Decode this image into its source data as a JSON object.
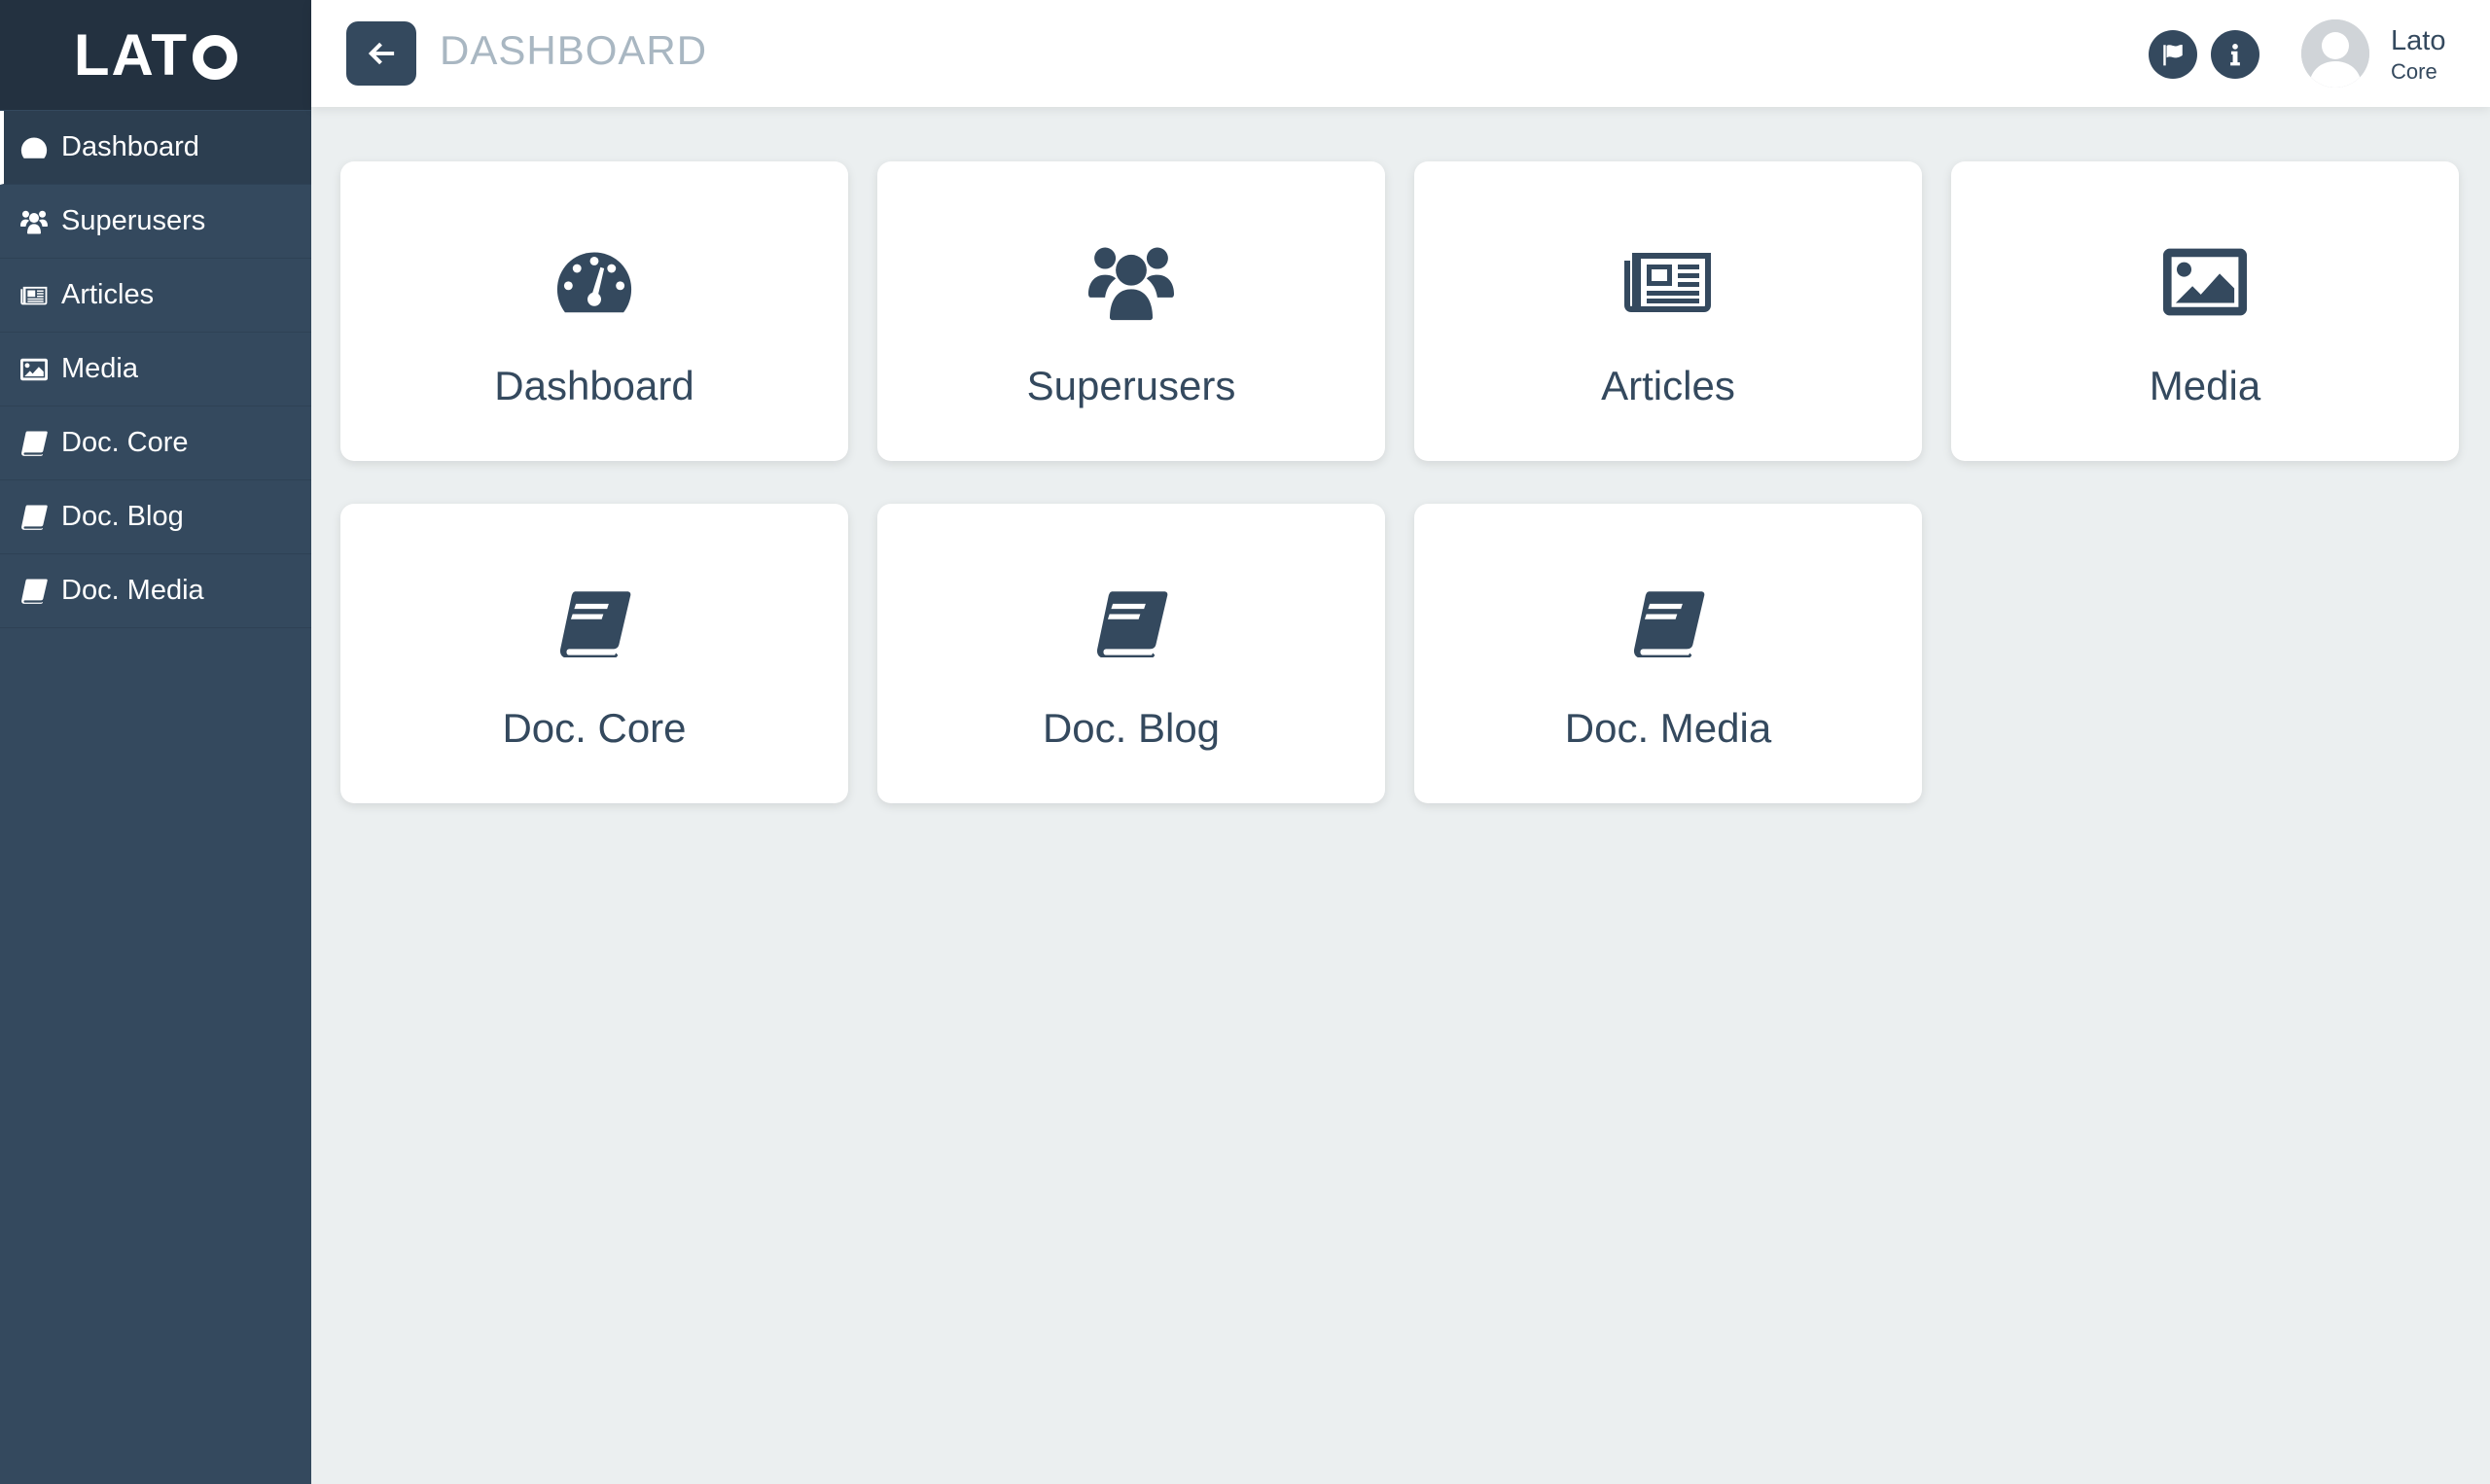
{
  "app": {
    "logo": "LATO"
  },
  "sidebar": {
    "items": [
      {
        "label": "Dashboard",
        "icon": "tachometer-icon",
        "active": true
      },
      {
        "label": "Superusers",
        "icon": "users-icon"
      },
      {
        "label": "Articles",
        "icon": "newspaper-icon"
      },
      {
        "label": "Media",
        "icon": "image-icon"
      },
      {
        "label": "Doc. Core",
        "icon": "book-icon"
      },
      {
        "label": "Doc. Blog",
        "icon": "book-icon"
      },
      {
        "label": "Doc. Media",
        "icon": "book-icon"
      }
    ]
  },
  "header": {
    "title": "DASHBOARD",
    "back_icon": "arrow-left-icon",
    "flag_icon": "flag-icon",
    "info_icon": "info-icon",
    "user": {
      "name": "Lato",
      "role": "Core"
    }
  },
  "cards": [
    {
      "label": "Dashboard",
      "icon": "tachometer-icon"
    },
    {
      "label": "Superusers",
      "icon": "users-icon"
    },
    {
      "label": "Articles",
      "icon": "newspaper-icon"
    },
    {
      "label": "Media",
      "icon": "image-icon"
    },
    {
      "label": "Doc. Core",
      "icon": "book-icon"
    },
    {
      "label": "Doc. Blog",
      "icon": "book-icon"
    },
    {
      "label": "Doc. Media",
      "icon": "book-icon"
    }
  ],
  "colors": {
    "sidebar": "#34495e",
    "logo_bg": "#233140",
    "page_bg": "#ebeff0",
    "accent": "#34495e",
    "title_muted": "#a9b7c2"
  }
}
